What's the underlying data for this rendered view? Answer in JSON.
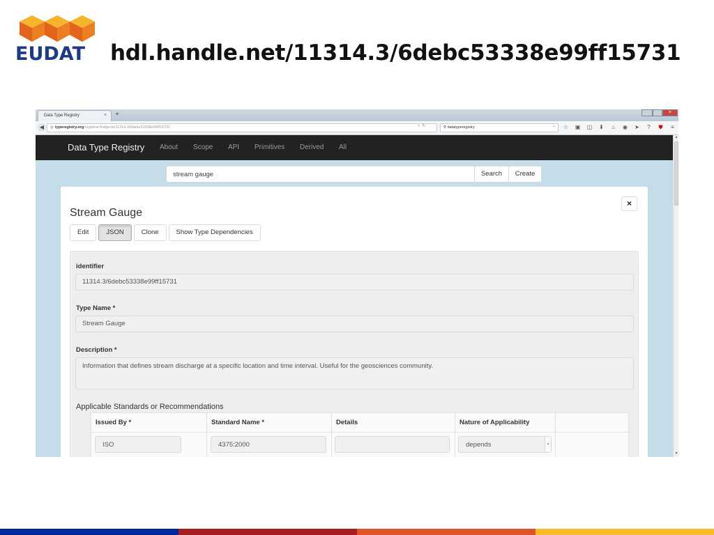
{
  "slide": {
    "logo_text": "EUDAT",
    "title": "hdl.handle.net/11314.3/6debc53338e99ff15731",
    "footer_colors": [
      "#00269b",
      "#a51e1f",
      "#e05526",
      "#fbba27"
    ]
  },
  "browser": {
    "tab_title": "Data Type Registry",
    "tab_close": "×",
    "new_tab": "+",
    "url_host": "typeregistry.org",
    "url_path": "/registrar/#objects/11314.3/6debc53338e99ff15731",
    "search_engine_query": "datatyperegistry",
    "toolbar_icons": [
      "star-icon",
      "clipboard-icon",
      "pocket-icon",
      "download-icon",
      "home-icon",
      "chat-icon",
      "send-icon",
      "help-icon",
      "shield-icon",
      "menu-icon"
    ]
  },
  "app": {
    "brand": "Data Type Registry",
    "nav": [
      "About",
      "Scope",
      "API",
      "Primitives",
      "Derived",
      "All"
    ],
    "search_value": "stream gauge",
    "search_button": "Search",
    "create_button": "Create"
  },
  "modal": {
    "close": "×",
    "title": "Stream Gauge",
    "buttons": [
      "Edit",
      "JSON",
      "Clone",
      "Show Type Dependencies"
    ],
    "active_button": "JSON",
    "identifier_label": "identifier",
    "identifier_value": "11314.3/6debc53338e99ff15731",
    "type_name_label": "Type Name *",
    "type_name_value": "Stream Gauge",
    "description_label": "Description *",
    "description_value": "Information that defines stream discharge at a specific location and time interval. Useful for the geosciences community.",
    "standards_title": "Applicable Standards or Recommendations",
    "standards_table": {
      "headers": [
        "Issued By *",
        "Standard Name *",
        "Details",
        "Nature of Applicability",
        ""
      ],
      "rows": [
        {
          "issued_by": "ISO",
          "standard_name": "4375:2000",
          "details": "",
          "nature": "depends"
        }
      ]
    }
  }
}
